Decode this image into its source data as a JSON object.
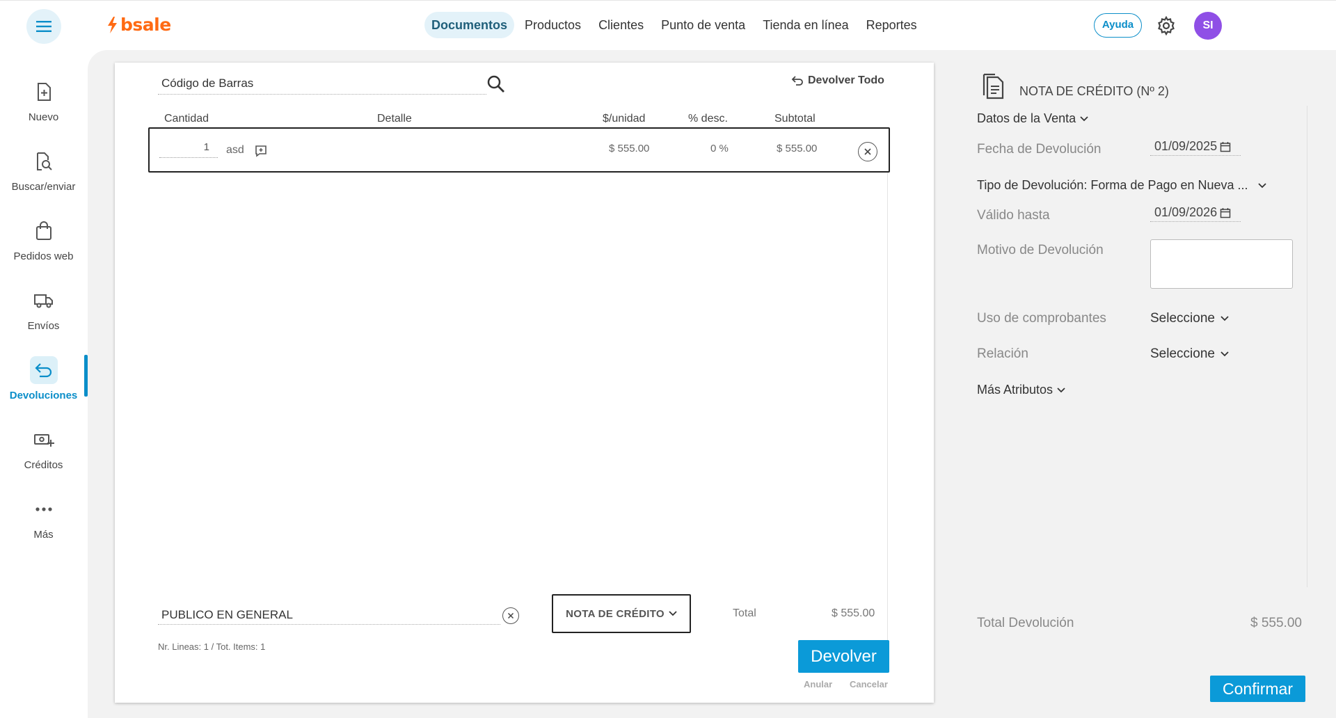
{
  "brand": {
    "logo_text": "bsale",
    "accent": "#0b9ad8",
    "logo_color": "#ff6a13"
  },
  "topnav": {
    "items": [
      "Documentos",
      "Productos",
      "Clientes",
      "Punto de venta",
      "Tienda en línea",
      "Reportes"
    ],
    "active": "Documentos",
    "help_label": "Ayuda",
    "avatar_initials": "SI"
  },
  "sidebar": {
    "items": [
      {
        "label": "Nuevo",
        "icon": "file-plus-icon"
      },
      {
        "label": "Buscar/enviar",
        "icon": "file-search-icon"
      },
      {
        "label": "Pedidos web",
        "icon": "shopping-bag-icon"
      },
      {
        "label": "Envíos",
        "icon": "truck-icon"
      },
      {
        "label": "Devoluciones",
        "icon": "return-arrow-icon"
      },
      {
        "label": "Créditos",
        "icon": "money-plus-icon"
      },
      {
        "label": "Más",
        "icon": "more-dots-icon"
      }
    ],
    "active": "Devoluciones"
  },
  "document": {
    "barcode_placeholder": "Código de Barras",
    "return_all_label": "Devolver Todo",
    "columns": [
      "Cantidad",
      "Detalle",
      "$/unidad",
      "% desc.",
      "Subtotal"
    ],
    "rows": [
      {
        "quantity": "1",
        "detail": "asd",
        "unit_price": "$ 555.00",
        "discount": "0 %",
        "subtotal": "$ 555.00"
      }
    ],
    "client": "PUBLICO EN GENERAL",
    "doc_type": "NOTA DE CRÉDITO",
    "total_label": "Total",
    "total_value": "$ 555.00",
    "counts": "Nr. Lineas: 1 / Tot. Items: 1",
    "return_button": "Devolver",
    "void_link": "Anular",
    "cancel_link": "Cancelar"
  },
  "panel": {
    "title": "NOTA DE CRÉDITO (Nº 2)",
    "sale_data": "Datos de la Venta",
    "return_date_label": "Fecha de Devolución",
    "return_date": "01/09/2025",
    "return_type": "Tipo de Devolución: Forma de Pago en Nueva ...",
    "valid_until_label": "Válido hasta",
    "valid_until": "01/09/2026",
    "reason_label": "Motivo de Devolución",
    "usage_label": "Uso de comprobantes",
    "usage_value": "Seleccione",
    "relation_label": "Relación",
    "relation_value": "Seleccione",
    "more_attributes": "Más Atributos",
    "total_label": "Total Devolución",
    "total_value": "$ 555.00",
    "confirm_button": "Confirmar"
  }
}
